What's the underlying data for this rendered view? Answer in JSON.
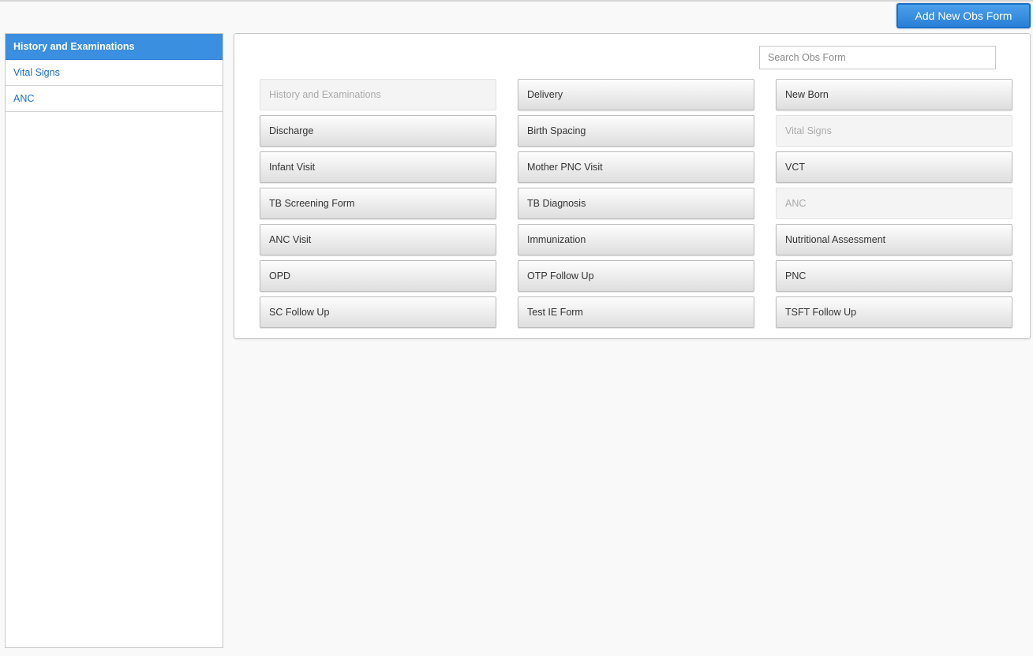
{
  "header": {
    "add_button_label": "Add New Obs Form"
  },
  "sidebar": {
    "items": [
      {
        "label": "History and Examinations",
        "active": true
      },
      {
        "label": "Vital Signs",
        "active": false
      },
      {
        "label": "ANC",
        "active": false
      }
    ]
  },
  "search": {
    "placeholder": "Search Obs Form",
    "value": ""
  },
  "forms": [
    {
      "label": "History and Examinations",
      "disabled": true
    },
    {
      "label": "Delivery",
      "disabled": false
    },
    {
      "label": "New Born",
      "disabled": false
    },
    {
      "label": "Discharge",
      "disabled": false
    },
    {
      "label": "Birth Spacing",
      "disabled": false
    },
    {
      "label": "Vital Signs",
      "disabled": true
    },
    {
      "label": "Infant Visit",
      "disabled": false
    },
    {
      "label": "Mother PNC Visit",
      "disabled": false
    },
    {
      "label": "VCT",
      "disabled": false
    },
    {
      "label": "TB Screening Form",
      "disabled": false
    },
    {
      "label": "TB Diagnosis",
      "disabled": false
    },
    {
      "label": "ANC",
      "disabled": true
    },
    {
      "label": "ANC Visit",
      "disabled": false
    },
    {
      "label": "Immunization",
      "disabled": false
    },
    {
      "label": "Nutritional Assessment",
      "disabled": false
    },
    {
      "label": "OPD",
      "disabled": false
    },
    {
      "label": "OTP Follow Up",
      "disabled": false
    },
    {
      "label": "PNC",
      "disabled": false
    },
    {
      "label": "SC Follow Up",
      "disabled": false
    },
    {
      "label": "Test IE Form",
      "disabled": false
    },
    {
      "label": "TSFT Follow Up",
      "disabled": false
    }
  ],
  "colors": {
    "accent": "#3b8fe0",
    "link": "#1a6fc4"
  }
}
